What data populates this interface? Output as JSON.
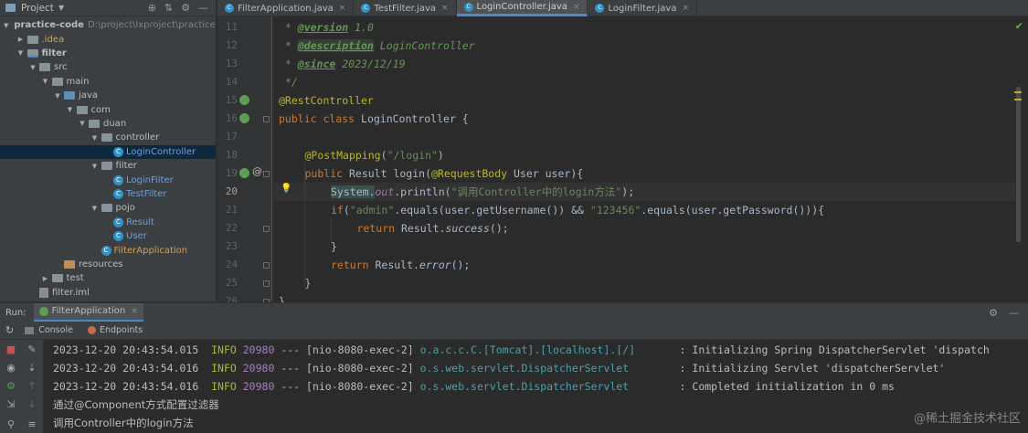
{
  "project_panel": {
    "title": "Project",
    "tree": [
      {
        "label": "practice-code",
        "path": "D:\\project\\lxproject\\practice-c",
        "level": 0,
        "expanded": true,
        "icon": "folder",
        "style": "bold"
      },
      {
        "label": ".idea",
        "level": 1,
        "expanded": false,
        "icon": "folder",
        "style": "yellow"
      },
      {
        "label": "filter",
        "level": 1,
        "expanded": true,
        "icon": "module-folder",
        "style": "bold"
      },
      {
        "label": "src",
        "level": 2,
        "expanded": true,
        "icon": "folder",
        "style": "plain"
      },
      {
        "label": "main",
        "level": 3,
        "expanded": true,
        "icon": "folder",
        "style": "plain"
      },
      {
        "label": "java",
        "level": 4,
        "expanded": true,
        "icon": "source-folder",
        "style": "plain"
      },
      {
        "label": "com",
        "level": 5,
        "expanded": true,
        "icon": "folder",
        "style": "plain"
      },
      {
        "label": "duan",
        "level": 6,
        "expanded": true,
        "icon": "folder",
        "style": "plain"
      },
      {
        "label": "controller",
        "level": 7,
        "expanded": true,
        "icon": "folder",
        "style": "plain"
      },
      {
        "label": "LoginController",
        "level": 8,
        "icon": "class",
        "style": "blue",
        "selected": true
      },
      {
        "label": "filter",
        "level": 7,
        "expanded": true,
        "icon": "folder",
        "style": "plain"
      },
      {
        "label": "LoginFilter",
        "level": 8,
        "icon": "class",
        "style": "blue"
      },
      {
        "label": "TestFilter",
        "level": 8,
        "icon": "class",
        "style": "blue"
      },
      {
        "label": "pojo",
        "level": 7,
        "expanded": true,
        "icon": "folder",
        "style": "plain"
      },
      {
        "label": "Result",
        "level": 8,
        "icon": "class",
        "style": "blue"
      },
      {
        "label": "User",
        "level": 8,
        "icon": "class",
        "style": "blue"
      },
      {
        "label": "FilterApplication",
        "level": 7,
        "icon": "class",
        "style": "orange"
      },
      {
        "label": "resources",
        "level": 4,
        "icon": "resources-folder",
        "style": "plain"
      },
      {
        "label": "test",
        "level": 3,
        "expanded": false,
        "icon": "folder",
        "style": "plain"
      },
      {
        "label": "filter.iml",
        "level": 2,
        "icon": "iml",
        "style": "plain"
      }
    ]
  },
  "editor": {
    "tabs": [
      {
        "label": "FilterApplication.java",
        "active": false
      },
      {
        "label": "TestFilter.java",
        "active": false
      },
      {
        "label": "LoginController.java",
        "active": true
      },
      {
        "label": "LoginFilter.java",
        "active": false
      }
    ],
    "current_line": "20",
    "lines": [
      {
        "no": "11",
        "indent": 0,
        "tokens": [
          {
            "t": " * ",
            "c": "doc"
          },
          {
            "t": "@version",
            "c": "tag"
          },
          {
            "t": " 1.0",
            "c": "doc"
          }
        ]
      },
      {
        "no": "12",
        "indent": 0,
        "tokens": [
          {
            "t": " * ",
            "c": "doc"
          },
          {
            "t": "@description",
            "c": "tag-hl"
          },
          {
            "t": " LoginController",
            "c": "doc"
          }
        ]
      },
      {
        "no": "13",
        "indent": 0,
        "tokens": [
          {
            "t": " * ",
            "c": "doc"
          },
          {
            "t": "@since",
            "c": "tag"
          },
          {
            "t": " 2023/12/19",
            "c": "doc"
          }
        ]
      },
      {
        "no": "14",
        "indent": 0,
        "tokens": [
          {
            "t": " */",
            "c": "doc"
          }
        ]
      },
      {
        "no": "15",
        "indent": 0,
        "tokens": [
          {
            "t": "@RestController",
            "c": "ann"
          }
        ]
      },
      {
        "no": "16",
        "indent": 0,
        "tokens": [
          {
            "t": "public class ",
            "c": "kw"
          },
          {
            "t": "LoginController {",
            "c": "plain"
          }
        ]
      },
      {
        "no": "17",
        "indent": 0,
        "tokens": []
      },
      {
        "no": "18",
        "indent": 1,
        "tokens": [
          {
            "t": "@PostMapping",
            "c": "ann"
          },
          {
            "t": "(",
            "c": "plain"
          },
          {
            "t": "\"/login\"",
            "c": "str"
          },
          {
            "t": ")",
            "c": "plain"
          }
        ]
      },
      {
        "no": "19",
        "indent": 1,
        "tokens": [
          {
            "t": "public ",
            "c": "kw"
          },
          {
            "t": "Result ",
            "c": "plain"
          },
          {
            "t": "login",
            "c": "plain"
          },
          {
            "t": "(",
            "c": "plain"
          },
          {
            "t": "@RequestBody",
            "c": "ann"
          },
          {
            "t": " User user){",
            "c": "plain"
          }
        ]
      },
      {
        "no": "20",
        "indent": 2,
        "tokens": [
          {
            "t": "System.",
            "c": "hl"
          },
          {
            "t": "out",
            "c": "static"
          },
          {
            "t": ".println(",
            "c": "plain"
          },
          {
            "t": "\"调用Controller中的login方法\"",
            "c": "str"
          },
          {
            "t": ");",
            "c": "plain"
          }
        ]
      },
      {
        "no": "21",
        "indent": 2,
        "tokens": [
          {
            "t": "if",
            "c": "kw"
          },
          {
            "t": "(",
            "c": "plain"
          },
          {
            "t": "\"admin\"",
            "c": "str"
          },
          {
            "t": ".equals(user.getUsername()) && ",
            "c": "plain"
          },
          {
            "t": "\"123456\"",
            "c": "str"
          },
          {
            "t": ".equals(user.getPassword())){",
            "c": "plain"
          }
        ]
      },
      {
        "no": "22",
        "indent": 3,
        "tokens": [
          {
            "t": "return ",
            "c": "kw"
          },
          {
            "t": "Result.",
            "c": "plain"
          },
          {
            "t": "success",
            "c": "italic"
          },
          {
            "t": "();",
            "c": "plain"
          }
        ]
      },
      {
        "no": "23",
        "indent": 2,
        "tokens": [
          {
            "t": "}",
            "c": "plain"
          }
        ]
      },
      {
        "no": "24",
        "indent": 2,
        "tokens": [
          {
            "t": "return ",
            "c": "kw"
          },
          {
            "t": "Result.",
            "c": "plain"
          },
          {
            "t": "error",
            "c": "italic"
          },
          {
            "t": "();",
            "c": "plain"
          }
        ]
      },
      {
        "no": "25",
        "indent": 1,
        "tokens": [
          {
            "t": "}",
            "c": "plain"
          }
        ]
      },
      {
        "no": "26",
        "indent": 0,
        "tokens": [
          {
            "t": "}",
            "c": "plain"
          }
        ]
      }
    ]
  },
  "run_panel": {
    "label": "Run:",
    "config_tab": "FilterApplication",
    "subtabs": [
      "Console",
      "Endpoints"
    ],
    "console_lines": [
      {
        "ts": "2023-12-20 20:43:54.015",
        "level": "INFO",
        "pid": "20980",
        "sep": "---",
        "thread": "[nio-8080-exec-2]",
        "logger": "o.a.c.c.C.[Tomcat].[localhost].[/]      ",
        "msg": " : Initializing Spring DispatcherServlet 'dispatch"
      },
      {
        "ts": "2023-12-20 20:43:54.016",
        "level": "INFO",
        "pid": "20980",
        "sep": "---",
        "thread": "[nio-8080-exec-2]",
        "logger": "o.s.web.servlet.DispatcherServlet       ",
        "msg": " : Initializing Servlet 'dispatcherServlet'"
      },
      {
        "ts": "2023-12-20 20:43:54.016",
        "level": "INFO",
        "pid": "20980",
        "sep": "---",
        "thread": "[nio-8080-exec-2]",
        "logger": "o.s.web.servlet.DispatcherServlet       ",
        "msg": " : Completed initialization in 0 ms"
      },
      {
        "plain": "通过@Component方式配置过滤器"
      },
      {
        "plain": "调用Controller中的login方法"
      }
    ]
  },
  "watermark": "@稀土掘金技术社区"
}
